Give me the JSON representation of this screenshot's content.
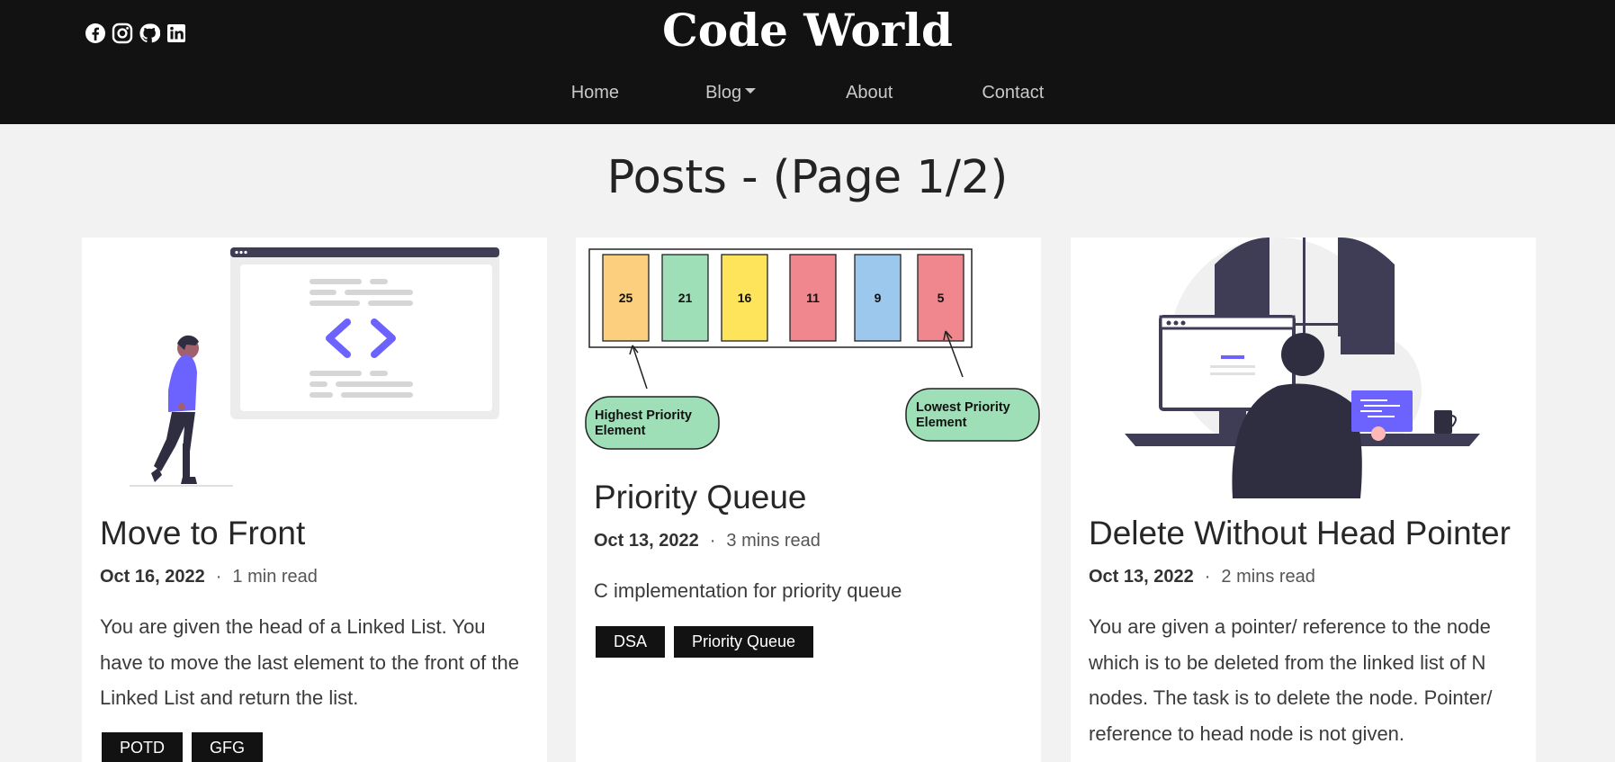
{
  "header": {
    "brand": "Code World",
    "socials": [
      "facebook-icon",
      "instagram-icon",
      "github-icon",
      "linkedin-icon"
    ],
    "nav": {
      "home": "Home",
      "blog": "Blog",
      "about": "About",
      "contact": "Contact"
    }
  },
  "page": {
    "title": "Posts - (Page 1/2)"
  },
  "posts": [
    {
      "title": "Move to Front",
      "date": "Oct 16, 2022",
      "separator": "·",
      "read": "1 min read",
      "description": "You are given the head of a Linked List. You have to move the last element to the front of the Linked List and return the list.",
      "tags": [
        "POTD",
        "GFG"
      ]
    },
    {
      "title": "Priority Queue",
      "date": "Oct 13, 2022",
      "separator": "·",
      "read": "3 mins read",
      "description": "C implementation for priority queue",
      "tags": [
        "DSA",
        "Priority Queue"
      ],
      "diagram": {
        "values": [
          "25",
          "21",
          "16",
          "11",
          "9",
          "5"
        ],
        "colors": [
          "#fbcf7d",
          "#9edfb8",
          "#fde45a",
          "#f0878f",
          "#9dc8ee",
          "#f0878f"
        ],
        "highest_label_1": "Highest Priority",
        "highest_label_2": "Element",
        "lowest_label_1": "Lowest Priority",
        "lowest_label_2": "Element"
      }
    },
    {
      "title": "Delete Without Head Pointer",
      "date": "Oct 13, 2022",
      "separator": "·",
      "read": "2 mins read",
      "description": "You are given a pointer/ reference to the node which is to be deleted from the linked list of N nodes. The task is to delete the node. Pointer/ reference to head node is not given.",
      "tags": []
    }
  ],
  "colors": {
    "header_bg": "#121212",
    "accent": "#6c63ff",
    "tag_bg": "#121212"
  }
}
